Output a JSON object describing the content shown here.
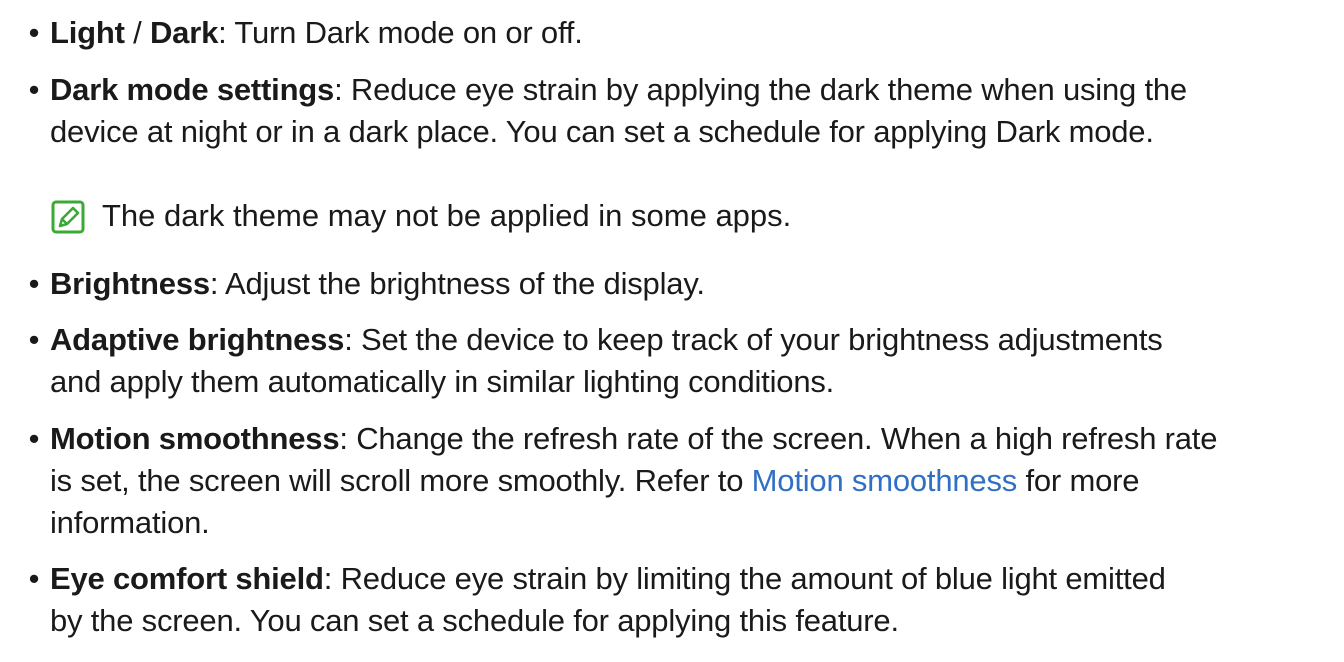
{
  "items": [
    {
      "term_a": "Light",
      "sep": " / ",
      "term_b": "Dark",
      "desc": ": Turn Dark mode on or off."
    },
    {
      "term": "Dark mode settings",
      "desc_line1": ": Reduce eye strain by applying the dark theme when using the",
      "desc_line2": "device at night or in a dark place. You can set a schedule for applying Dark mode."
    },
    {
      "term": "Brightness",
      "desc": ": Adjust the brightness of the display."
    },
    {
      "term": "Adaptive brightness",
      "desc_line1": ": Set the device to keep track of your brightness adjustments",
      "desc_line2": "and apply them automatically in similar lighting conditions."
    },
    {
      "term": "Motion smoothness",
      "desc_line1": ": Change the refresh rate of the screen. When a high refresh rate",
      "desc_line2_before": "is set, the screen will scroll more smoothly. Refer to ",
      "link": "Motion smoothness",
      "desc_line2_after": " for more",
      "desc_line3": "information."
    },
    {
      "term": "Eye comfort shield",
      "desc_line1": ": Reduce eye strain by limiting the amount of blue light emitted",
      "desc_line2": "by the screen. You can set a schedule for applying this feature."
    }
  ],
  "note": {
    "text": "The dark theme may not be applied in some apps.",
    "icon": "note-pencil-icon"
  },
  "bullet_char": "•",
  "colors": {
    "text": "#1a1a1a",
    "link": "#2f6fc4",
    "note_icon": "#3aa935"
  }
}
